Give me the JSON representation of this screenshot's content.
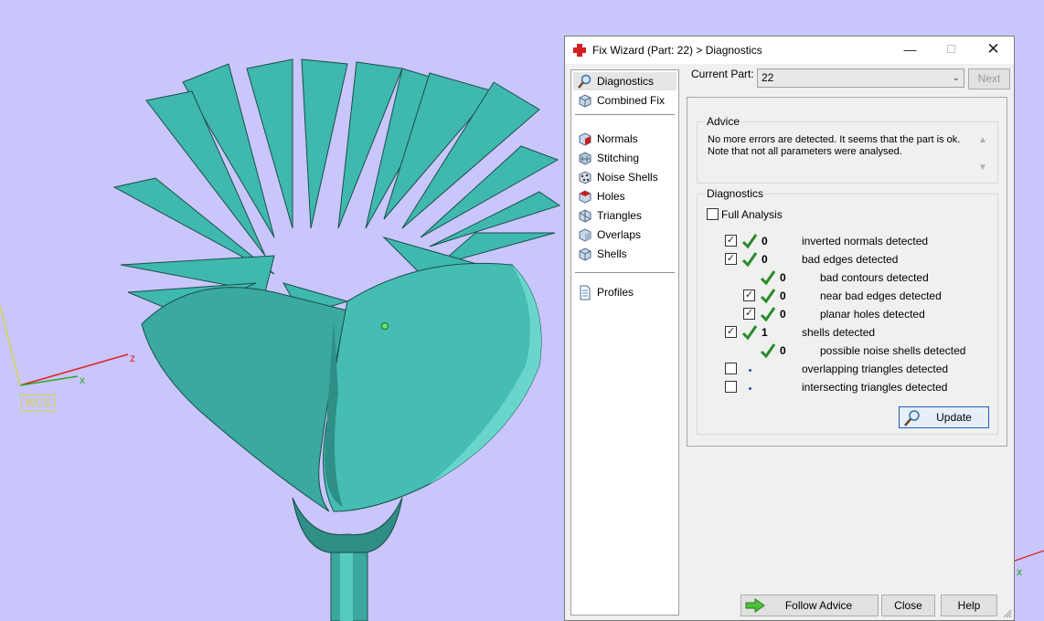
{
  "viewport": {
    "wcs_label": "WCS",
    "axis_z": "z",
    "axis_x": "x",
    "background_color": "#c8c6fb",
    "model_color": "#3fb8ae"
  },
  "dialog": {
    "title": "Fix Wizard (Part: 22) > Diagnostics",
    "nav": [
      {
        "label": "Diagnostics",
        "icon": "magnifier-icon",
        "selected": true
      },
      {
        "label": "Combined Fix",
        "icon": "cube-icon"
      },
      {
        "label": "Normals",
        "icon": "normals-cube-icon"
      },
      {
        "label": "Stitching",
        "icon": "stitching-cube-icon"
      },
      {
        "label": "Noise Shells",
        "icon": "noise-shells-icon"
      },
      {
        "label": "Holes",
        "icon": "holes-cube-icon"
      },
      {
        "label": "Triangles",
        "icon": "triangles-cube-icon"
      },
      {
        "label": "Overlaps",
        "icon": "overlaps-cube-icon"
      },
      {
        "label": "Shells",
        "icon": "shells-cube-icon"
      },
      {
        "label": "Profiles",
        "icon": "document-icon"
      }
    ],
    "current_part_label": "Current Part:",
    "current_part_value": "22",
    "next_label": "Next",
    "advice": {
      "title": "Advice",
      "text": "No more errors are detected. It seems that the part is ok. Note that not all parameters were analysed."
    },
    "diagnostics": {
      "title": "Diagnostics",
      "full_analysis_label": "Full Analysis",
      "full_analysis_checked": false,
      "rows": [
        {
          "label": "inverted normals detected",
          "count": "0",
          "checked": true,
          "status": "ok",
          "indent": 0
        },
        {
          "label": "bad edges detected",
          "count": "0",
          "checked": true,
          "status": "ok",
          "indent": 0
        },
        {
          "label": "bad contours detected",
          "count": "0",
          "checked": null,
          "status": "ok",
          "indent": 1
        },
        {
          "label": "near bad edges detected",
          "count": "0",
          "checked": true,
          "status": "ok",
          "indent": 1
        },
        {
          "label": "planar holes detected",
          "count": "0",
          "checked": true,
          "status": "ok",
          "indent": 1
        },
        {
          "label": "shells detected",
          "count": "1",
          "checked": true,
          "status": "ok",
          "indent": 0
        },
        {
          "label": "possible noise shells detected",
          "count": "0",
          "checked": null,
          "status": "ok",
          "indent": 1
        },
        {
          "label": "overlapping triangles detected",
          "count": "",
          "checked": false,
          "status": "not-analysed",
          "indent": 0
        },
        {
          "label": "intersecting triangles detected",
          "count": "",
          "checked": false,
          "status": "not-analysed",
          "indent": 0
        }
      ],
      "update_label": "Update"
    },
    "footer": {
      "follow_advice_label": "Follow Advice",
      "close_label": "Close",
      "help_label": "Help"
    }
  }
}
